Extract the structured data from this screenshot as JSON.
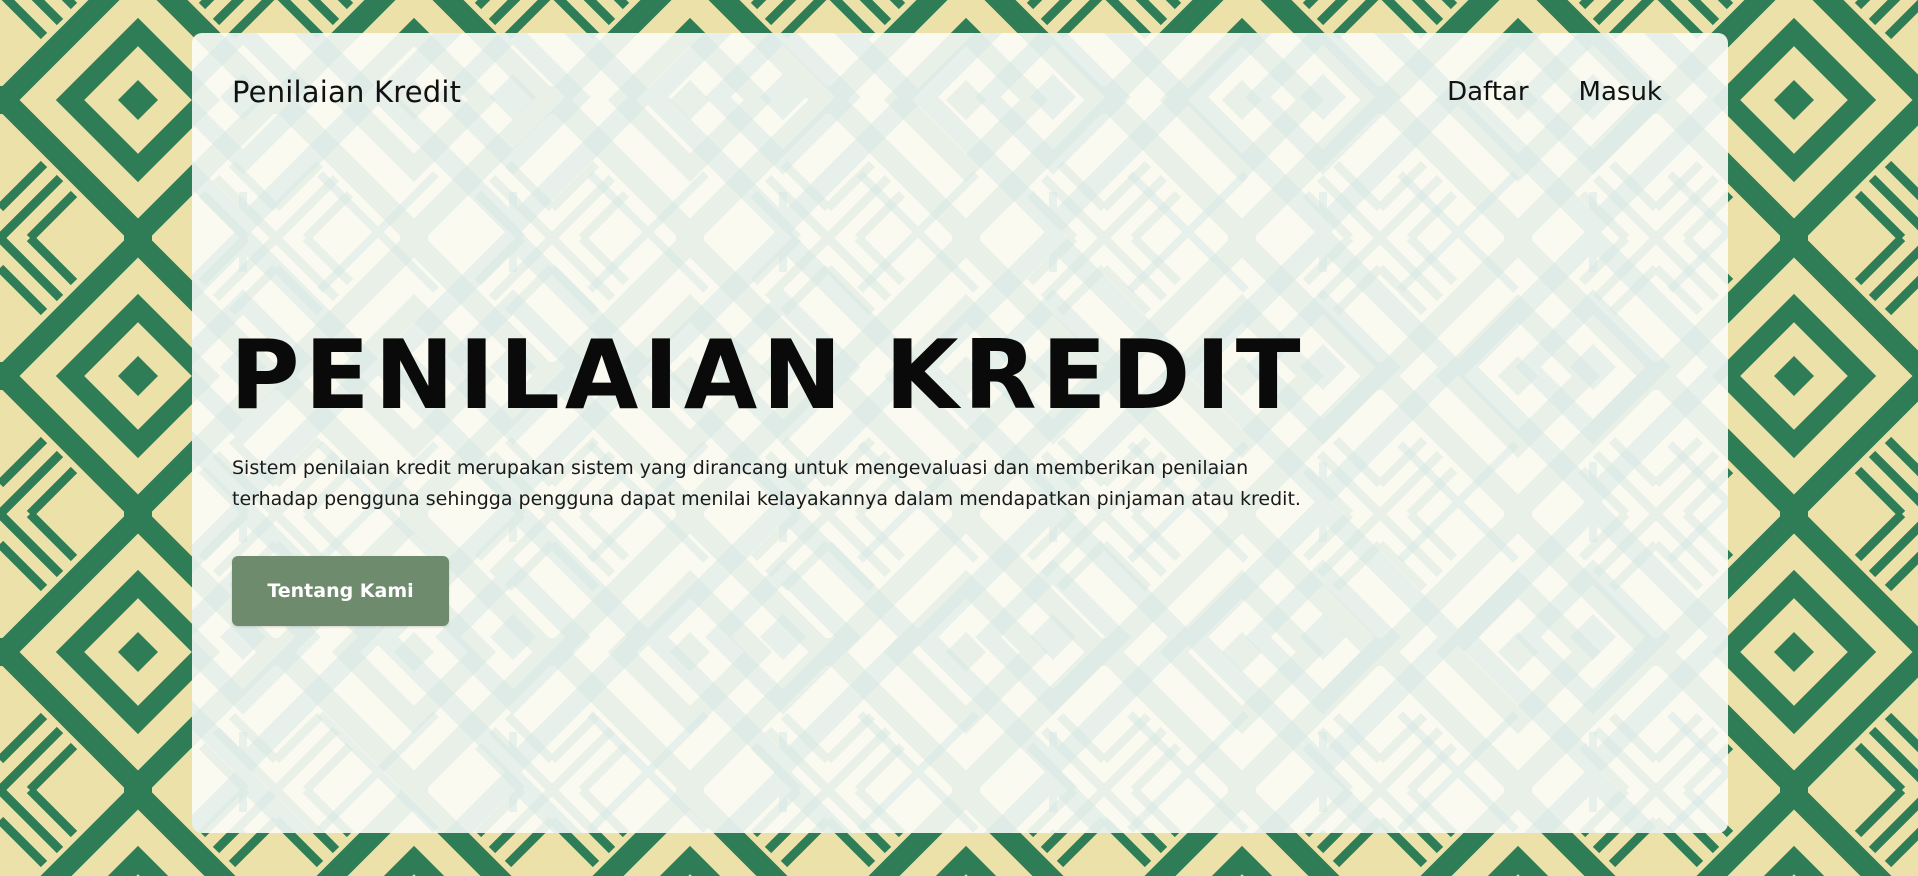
{
  "theme": {
    "pattern_green": "#2f7d57",
    "pattern_cream": "#ece1a8",
    "card_pattern": "#d7e8e6",
    "button_color": "#6f8b6e"
  },
  "header": {
    "brand": "Penilaian Kredit",
    "nav": [
      {
        "label": "Daftar"
      },
      {
        "label": "Masuk"
      }
    ]
  },
  "hero": {
    "title": "PENILAIAN KREDIT",
    "description": "Sistem penilaian kredit merupakan sistem yang dirancang untuk mengevaluasi dan memberikan penilaian terhadap pengguna sehingga pengguna dapat menilai kelayakannya dalam mendapatkan pinjaman atau kredit.",
    "cta_label": "Tentang Kami"
  }
}
